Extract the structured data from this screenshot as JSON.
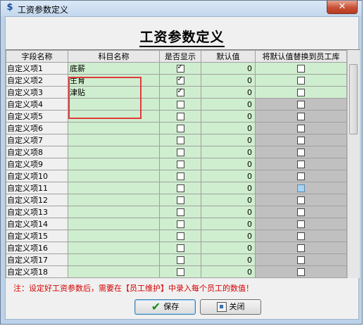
{
  "window": {
    "title": "工资参数定义",
    "close_glyph": "✕"
  },
  "heading": "工资参数定义",
  "table": {
    "columns": [
      "字段名称",
      "科目名称",
      "是否显示",
      "默认值",
      "将默认值替换到员工库"
    ],
    "rows": [
      {
        "field": "自定义项1",
        "subject": "底薪",
        "show": true,
        "default": "0",
        "replace_highlight": false
      },
      {
        "field": "自定义项2",
        "subject": "生育",
        "show": true,
        "default": "0",
        "replace_highlight": false
      },
      {
        "field": "自定义项3",
        "subject": "津贴",
        "show": true,
        "default": "0",
        "replace_highlight": false
      },
      {
        "field": "自定义项4",
        "subject": "",
        "show": false,
        "default": "0",
        "replace_highlight": false
      },
      {
        "field": "自定义项5",
        "subject": "",
        "show": false,
        "default": "0",
        "replace_highlight": false
      },
      {
        "field": "自定义项6",
        "subject": "",
        "show": false,
        "default": "0",
        "replace_highlight": false
      },
      {
        "field": "自定义项7",
        "subject": "",
        "show": false,
        "default": "0",
        "replace_highlight": false
      },
      {
        "field": "自定义项8",
        "subject": "",
        "show": false,
        "default": "0",
        "replace_highlight": false
      },
      {
        "field": "自定义项9",
        "subject": "",
        "show": false,
        "default": "0",
        "replace_highlight": false
      },
      {
        "field": "自定义项10",
        "subject": "",
        "show": false,
        "default": "0",
        "replace_highlight": false
      },
      {
        "field": "自定义项11",
        "subject": "",
        "show": false,
        "default": "0",
        "replace_highlight": true
      },
      {
        "field": "自定义项12",
        "subject": "",
        "show": false,
        "default": "0",
        "replace_highlight": false
      },
      {
        "field": "自定义项13",
        "subject": "",
        "show": false,
        "default": "0",
        "replace_highlight": false
      },
      {
        "field": "自定义项14",
        "subject": "",
        "show": false,
        "default": "0",
        "replace_highlight": false
      },
      {
        "field": "自定义项15",
        "subject": "",
        "show": false,
        "default": "0",
        "replace_highlight": false
      },
      {
        "field": "自定义项16",
        "subject": "",
        "show": false,
        "default": "0",
        "replace_highlight": false
      },
      {
        "field": "自定义项17",
        "subject": "",
        "show": false,
        "default": "0",
        "replace_highlight": false
      },
      {
        "field": "自定义项18",
        "subject": "",
        "show": false,
        "default": "0",
        "replace_highlight": false
      }
    ]
  },
  "note": "注：设定好工资参数后，需要在【员工维护】中录入每个员工的数值！",
  "buttons": {
    "save": "保存",
    "close": "关闭"
  },
  "colors": {
    "row_green": "#cfeecf",
    "row_gray": "#c0c0c0",
    "note_red": "#d40000",
    "highlight_box": "#e23a3a"
  },
  "icons": {
    "save": "check-icon",
    "close": "exit-door-icon",
    "app": "app-logo-icon"
  }
}
